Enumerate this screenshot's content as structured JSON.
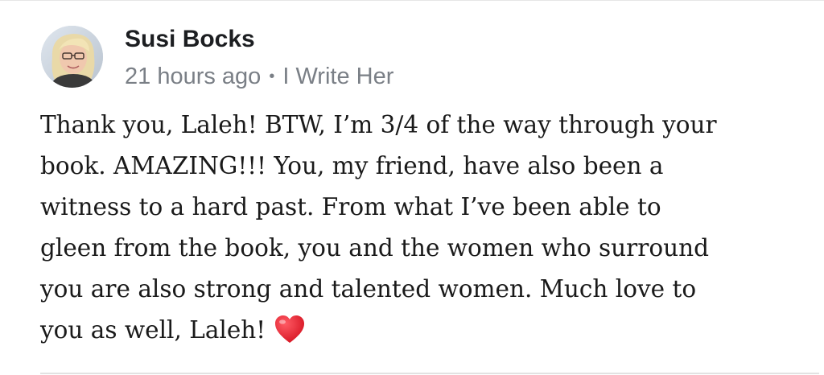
{
  "comment": {
    "author": "Susi Bocks",
    "timestamp": "21 hours ago",
    "separator": "•",
    "context": "I Write Her",
    "body_lines": [
      "Thank you, Laleh! BTW, I’m 3/4 of the way through your",
      "book. AMAZING!!! You, my friend, have also been a",
      "witness to a hard past. From what I’ve been able to",
      "gleen from the book, you and the women who surround",
      "you are also strong and talented women. Much love to",
      "you as well, Laleh!"
    ],
    "emoji_icon": "red-heart-icon",
    "colors": {
      "author": "#1c1e21",
      "meta": "#7a7f86",
      "body": "#1a1a1a",
      "heart": "#e0202e"
    }
  }
}
